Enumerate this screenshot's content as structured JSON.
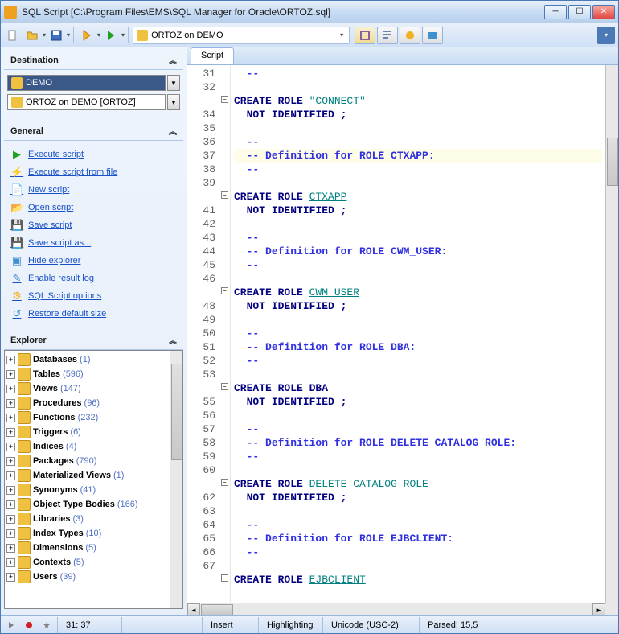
{
  "window": {
    "title": "SQL Script [C:\\Program Files\\EMS\\SQL Manager for Oracle\\ORTOZ.sql]"
  },
  "toolbar": {
    "connection": "ORTOZ on DEMO"
  },
  "sidebar": {
    "destination_label": "Destination",
    "dest_db": "DEMO",
    "dest_conn": "ORTOZ on DEMO [ORTOZ]",
    "general_label": "General",
    "actions": [
      "Execute script",
      "Execute script from file",
      "New script",
      "Open script",
      "Save script",
      "Save script as...",
      "Hide explorer",
      "Enable result log",
      "SQL Script options",
      "Restore default size"
    ],
    "explorer_label": "Explorer",
    "tree": [
      {
        "label": "Databases",
        "count": "(1)"
      },
      {
        "label": "Tables",
        "count": "(596)"
      },
      {
        "label": "Views",
        "count": "(147)"
      },
      {
        "label": "Procedures",
        "count": "(96)"
      },
      {
        "label": "Functions",
        "count": "(232)"
      },
      {
        "label": "Triggers",
        "count": "(6)"
      },
      {
        "label": "Indices",
        "count": "(4)"
      },
      {
        "label": "Packages",
        "count": "(790)"
      },
      {
        "label": "Materialized Views",
        "count": "(1)"
      },
      {
        "label": "Synonyms",
        "count": "(41)"
      },
      {
        "label": "Object Type Bodies",
        "count": "(166)"
      },
      {
        "label": "Libraries",
        "count": "(3)"
      },
      {
        "label": "Index Types",
        "count": "(10)"
      },
      {
        "label": "Dimensions",
        "count": "(5)"
      },
      {
        "label": "Contexts",
        "count": "(5)"
      },
      {
        "label": "Users",
        "count": "(39)"
      }
    ]
  },
  "editor": {
    "tab": "Script",
    "first_line": 31,
    "lines": [
      {
        "n": 31,
        "type": "cm",
        "t": "--"
      },
      {
        "n": 32,
        "type": "",
        "t": ""
      },
      {
        "n": "",
        "type": "create",
        "fold": true,
        "t1": "CREATE ROLE ",
        "link": "\"CONNECT\""
      },
      {
        "n": 34,
        "type": "noid",
        "t": "NOT IDENTIFIED ;"
      },
      {
        "n": 35,
        "type": "",
        "t": ""
      },
      {
        "n": 36,
        "type": "cm",
        "t": "--"
      },
      {
        "n": 37,
        "type": "cm",
        "hl": true,
        "t": "-- Definition for ROLE CTXAPP:"
      },
      {
        "n": 38,
        "type": "cm",
        "t": "--"
      },
      {
        "n": 39,
        "type": "",
        "t": ""
      },
      {
        "n": "",
        "type": "create",
        "fold": true,
        "t1": "CREATE ROLE ",
        "link": "CTXAPP"
      },
      {
        "n": 41,
        "type": "noid",
        "t": "NOT IDENTIFIED ;"
      },
      {
        "n": 42,
        "type": "",
        "t": ""
      },
      {
        "n": 43,
        "type": "cm",
        "t": "--"
      },
      {
        "n": 44,
        "type": "cm",
        "t": "-- Definition for ROLE CWM_USER:"
      },
      {
        "n": 45,
        "type": "cm",
        "t": "--"
      },
      {
        "n": 46,
        "type": "",
        "t": ""
      },
      {
        "n": "",
        "type": "create",
        "fold": true,
        "t1": "CREATE ROLE ",
        "link": "CWM_USER"
      },
      {
        "n": 48,
        "type": "noid",
        "t": "NOT IDENTIFIED ;"
      },
      {
        "n": 49,
        "type": "",
        "t": ""
      },
      {
        "n": 50,
        "type": "cm",
        "t": "--"
      },
      {
        "n": 51,
        "type": "cm",
        "t": "-- Definition for ROLE DBA:"
      },
      {
        "n": 52,
        "type": "cm",
        "t": "--"
      },
      {
        "n": 53,
        "type": "",
        "t": ""
      },
      {
        "n": "",
        "type": "create-plain",
        "fold": true,
        "t1": "CREATE ROLE DBA"
      },
      {
        "n": 55,
        "type": "noid",
        "t": "NOT IDENTIFIED ;"
      },
      {
        "n": 56,
        "type": "",
        "t": ""
      },
      {
        "n": 57,
        "type": "cm",
        "t": "--"
      },
      {
        "n": 58,
        "type": "cm",
        "t": "-- Definition for ROLE DELETE_CATALOG_ROLE:"
      },
      {
        "n": 59,
        "type": "cm",
        "t": "--"
      },
      {
        "n": 60,
        "type": "",
        "t": ""
      },
      {
        "n": "",
        "type": "create",
        "fold": true,
        "t1": "CREATE ROLE ",
        "link": "DELETE_CATALOG_ROLE"
      },
      {
        "n": 62,
        "type": "noid",
        "t": "NOT IDENTIFIED ;"
      },
      {
        "n": 63,
        "type": "",
        "t": ""
      },
      {
        "n": 64,
        "type": "cm",
        "t": "--"
      },
      {
        "n": 65,
        "type": "cm",
        "t": "-- Definition for ROLE EJBCLIENT:"
      },
      {
        "n": 66,
        "type": "cm",
        "t": "--"
      },
      {
        "n": 67,
        "type": "",
        "t": ""
      },
      {
        "n": "",
        "type": "create",
        "fold": true,
        "t1": "CREATE ROLE ",
        "link": "EJBCLIENT"
      }
    ]
  },
  "status": {
    "pos": "31:  37",
    "mode": "Insert",
    "highlight": "Highlighting",
    "encoding": "Unicode (USC-2)",
    "parsed": "Parsed! 15,5"
  }
}
